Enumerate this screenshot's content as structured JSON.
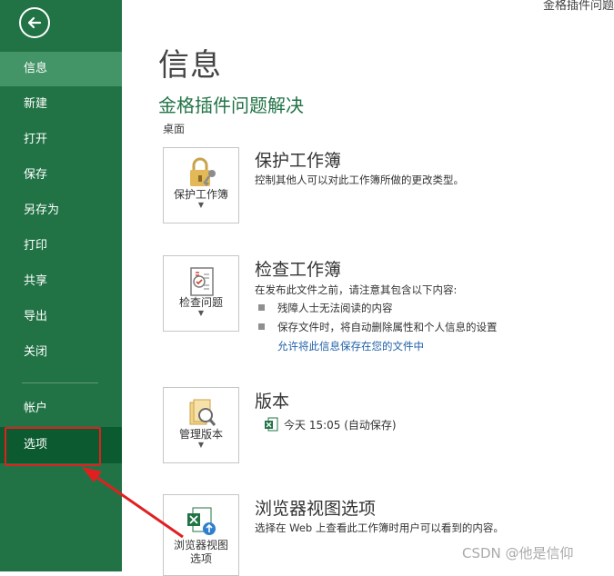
{
  "window": {
    "title": "金格插件问题"
  },
  "sidebar": {
    "items": [
      {
        "label": "信息"
      },
      {
        "label": "新建"
      },
      {
        "label": "打开"
      },
      {
        "label": "保存"
      },
      {
        "label": "另存为"
      },
      {
        "label": "打印"
      },
      {
        "label": "共享"
      },
      {
        "label": "导出"
      },
      {
        "label": "关闭"
      },
      {
        "label": "帐户"
      },
      {
        "label": "选项"
      }
    ]
  },
  "main": {
    "page_title": "信息",
    "file_name": "金格插件问题解决",
    "file_path": "桌面",
    "protect": {
      "button_label": "保护工作簿",
      "title": "保护工作簿",
      "desc": "控制其他人可以对此工作簿所做的更改类型。"
    },
    "inspect": {
      "button_label": "检查问题",
      "title": "检查工作簿",
      "desc": "在发布此文件之前，请注意其包含以下内容:",
      "bullets": [
        "残障人士无法阅读的内容",
        "保存文件时，将自动删除属性和个人信息的设置"
      ],
      "link": "允许将此信息保存在您的文件中"
    },
    "versions": {
      "button_label": "管理版本",
      "title": "版本",
      "entry": "今天 15:05 (自动保存)"
    },
    "browser": {
      "button_label_1": "浏览器视图",
      "button_label_2": "选项",
      "title": "浏览器视图选项",
      "desc": "选择在 Web 上查看此工作簿时用户可以看到的内容。"
    }
  },
  "watermark": "CSDN @他是信仰",
  "colors": {
    "sidebar": "#217346",
    "active": "#439467",
    "selected": "#0b5a30",
    "annotation": "#e02020"
  }
}
